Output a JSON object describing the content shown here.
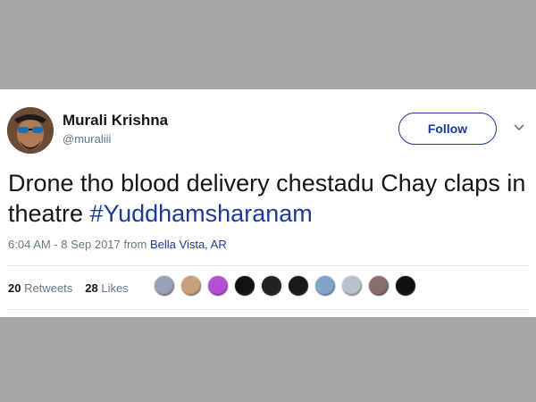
{
  "tweet": {
    "display_name": "Murali Krishna",
    "handle": "@muraliii",
    "follow_label": "Follow",
    "text": "Drone tho blood delivery chestadu Chay claps in theatre ",
    "hashtag": "#Yuddhamsharanam",
    "time_date": "6:04 AM - 8 Sep 2017 from ",
    "location": "Bella Vista, AR",
    "retweets_count": "20",
    "retweets_label": "Retweets",
    "likes_count": "28",
    "likes_label": "Likes"
  },
  "colors": {
    "link": "#1b3a9b",
    "text": "#14171a",
    "muted": "#657786",
    "page_bg": "#a8a5a5"
  },
  "icons": {
    "caret": "chevron-down-icon"
  },
  "likers": [
    "#9aa3b5",
    "#c8a07a",
    "#b44fd6",
    "#111111",
    "#222222",
    "#181818",
    "#7fa6c8",
    "#b9c2cc",
    "#8a6d6d",
    "#101010"
  ]
}
